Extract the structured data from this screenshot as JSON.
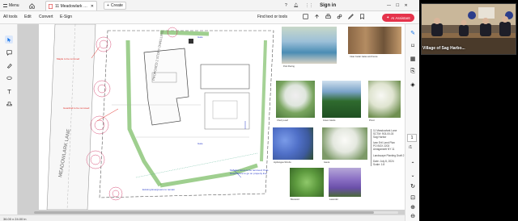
{
  "window": {
    "menu_label": "Menu",
    "doc_tab_label": "11 Meadowlark Lane 8-6...",
    "create_label": "Create",
    "signin_label": "Sign in"
  },
  "toolbar": {
    "all_tools": "All tools",
    "edit": "Edit",
    "convert": "Convert",
    "esign": "E-Sign",
    "find_text": "Find text or tools",
    "ai_assistant": "AI Assistant"
  },
  "drawing": {
    "labels": {
      "road": "MEADOWLARK LANE",
      "building_top": "PROPOSED 2 STORY DWELLING",
      "gate": "Gate",
      "maple_removed": "Maple to be removed",
      "guardrail": "Guardrail to be removed",
      "gate_lower": "Gate",
      "meadow_fence": "Meadow fence to be removed; Post-Guard fence to go on property line",
      "existing_evergreens": "Existing Evergreens to remain"
    }
  },
  "photos": [
    {
      "caption": "Pool Paving"
    },
    {
      "caption": "Clear Cedar Gates and Fence"
    },
    {
      "caption": "Cherry-Leaf"
    },
    {
      "caption": "Green Giants"
    },
    {
      "caption": "Privet"
    },
    {
      "caption": "Hydrangea Shrubs"
    },
    {
      "caption": "Gaura"
    },
    {
      "caption": "Boxwood"
    },
    {
      "caption": "Lavender"
    }
  ],
  "title_block": {
    "address": "11 Meadowlark Lane",
    "sctm": "SCTM: 903-00-03",
    "municipality": "Sag Harbor",
    "firm": "Ivan Ertl Land Plan",
    "po_box": "PO BOX 2203",
    "city": "Amagansett NY 11",
    "sheet_title": "Landscape Planting Draft 2",
    "date": "Date: July 8, 2024",
    "scale": "Scale: 1:8"
  },
  "status": {
    "page_size": "36.00 x 24.00 in",
    "page_number": "1",
    "page_total": "/1"
  },
  "video": {
    "room_label": "Village of Sag Harbo..."
  },
  "colors": {
    "ai_button": "#e5334b",
    "accent": "#1473e6",
    "annotation_red": "#e0302a",
    "annotation_blue": "#2b3cc9"
  }
}
